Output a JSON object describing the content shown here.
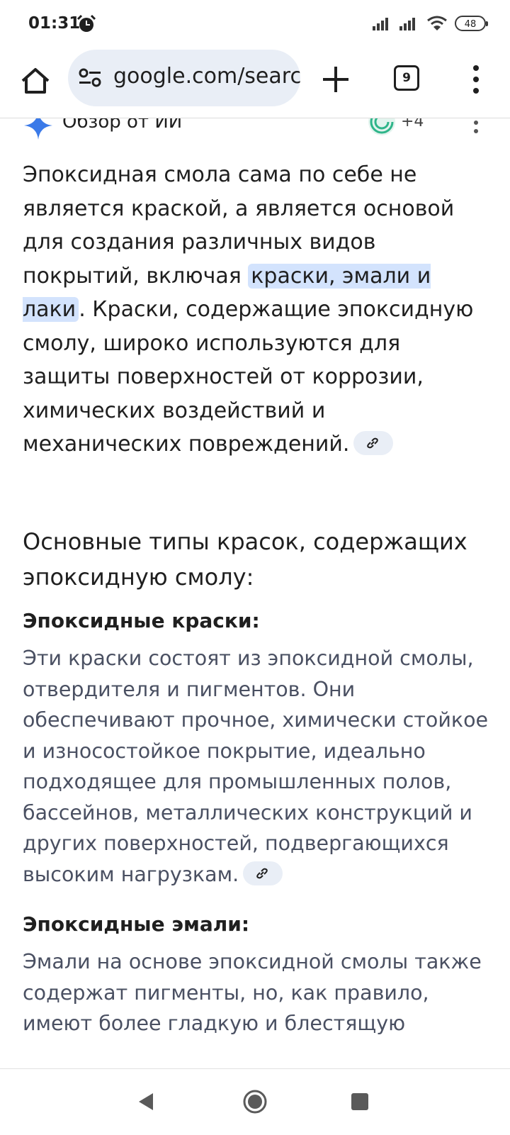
{
  "status": {
    "time": "01:31",
    "battery": "48"
  },
  "toolbar": {
    "url": "google.com/search",
    "tab_count": "9"
  },
  "overview": {
    "title": "Обзор от ИИ",
    "sources_count": "+4"
  },
  "intro": {
    "text_before": "Эпоксидная смола сама по себе не является краской, а является основой для создания различных видов покрытий, включая ",
    "highlight": "краски, эмали и лаки",
    "text_after": ". Краски, содержащие эпоксидную смолу, широко используются для защиты поверхностей от коррозии, химических воздействий и механических повреждений."
  },
  "section": {
    "heading": "Основные типы красок, содержащих эпоксидную смолу:",
    "items": [
      {
        "title": "Эпоксидные краски:",
        "text": "Эти краски состоят из эпоксидной смолы, отвердителя и пигментов. Они обеспечивают прочное, химически стойкое и износостойкое покрытие, идеально подходящее для промышленных полов, бассейнов, металлических конструкций и других поверхностей, подвергающихся высоким нагрузкам."
      },
      {
        "title": "Эпоксидные эмали:",
        "text": "Эмали на основе эпоксидной смолы также содержат пигменты, но, как правило, имеют более гладкую и блестящую"
      }
    ]
  },
  "colors": {
    "accent": "#d3e3fd",
    "urlbar": "#e9eef6",
    "muted_text": "#4a5062"
  }
}
